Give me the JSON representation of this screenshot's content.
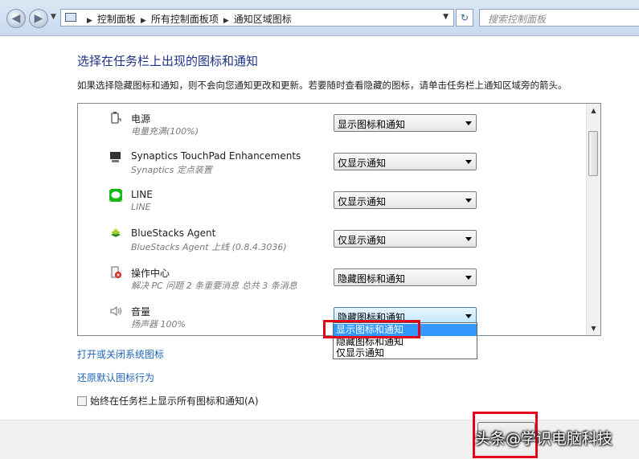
{
  "address": {
    "crumbs": [
      "控制面板",
      "所有控制面板项",
      "通知区域图标"
    ],
    "search_placeholder": "搜索控制面板"
  },
  "main": {
    "title": "选择在任务栏上出现的图标和通知",
    "description": "如果选择隐藏图标和通知，则不会向您通知更改和更新。若要随时查看隐藏的图标，请单击任务栏上通知区域旁的箭头。"
  },
  "items": [
    {
      "name": "电源",
      "sub": "电量充满(100%)",
      "value": "显示图标和通知",
      "icon": "power-icon"
    },
    {
      "name": "Synaptics TouchPad Enhancements",
      "sub": "Synaptics 定点装置",
      "value": "仅显示通知",
      "icon": "touchpad-icon"
    },
    {
      "name": "LINE",
      "sub": "LINE",
      "value": "仅显示通知",
      "icon": "line-app-icon"
    },
    {
      "name": "BlueStacks Agent",
      "sub": "BlueStacks Agent 上线 (0.8.4.3036)",
      "value": "仅显示通知",
      "icon": "bluestacks-icon"
    },
    {
      "name": "操作中心",
      "sub": "解决 PC 问题  2 条重要消息 总共 3 条消息",
      "value": "隐藏图标和通知",
      "icon": "action-center-icon"
    },
    {
      "name": "音量",
      "sub": "扬声器 100%",
      "value": "隐藏图标和通知",
      "icon": "speaker-icon"
    }
  ],
  "dropdown_options": [
    "显示图标和通知",
    "隐藏图标和通知",
    "仅显示通知"
  ],
  "links": {
    "system_icons": "打开或关闭系统图标",
    "restore_defaults": "还原默认图标行为"
  },
  "checkbox": {
    "label": "始终在任务栏上显示所有图标和通知(A)",
    "checked": false
  },
  "watermark": "头条@学识电脑科技",
  "colors": {
    "highlight": "#3399ff",
    "annotation": "#e3001b",
    "link": "#1e64b4",
    "title": "#1e3287"
  }
}
